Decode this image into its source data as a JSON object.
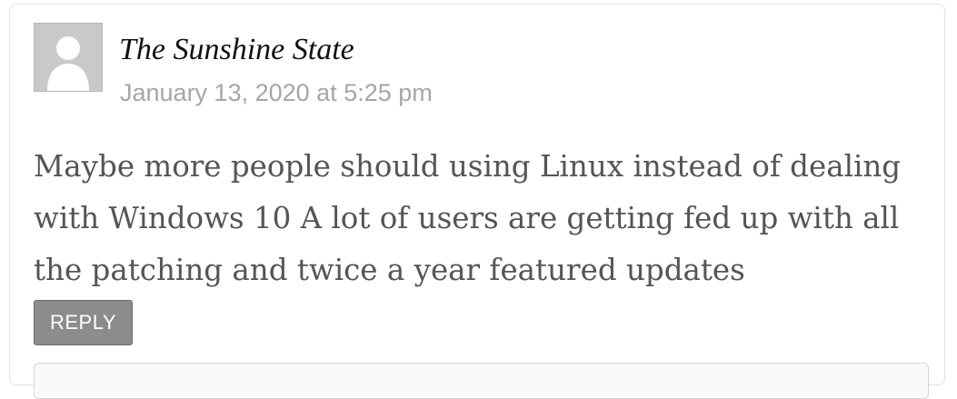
{
  "comment": {
    "author": "The Sunshine State",
    "timestamp": "January 13, 2020 at 5:25 pm",
    "body": "Maybe more people should using Linux instead of dealing with Windows 10 A lot of users are getting fed up with all the patching and twice a year featured updates",
    "reply_label": "REPLY",
    "avatar_icon": "default-user-avatar-icon"
  },
  "colors": {
    "avatar_background": "#c9c9c9",
    "timestamp_text": "#a6a6a6",
    "body_text": "#555555",
    "reply_button": "#8c8c8c"
  }
}
